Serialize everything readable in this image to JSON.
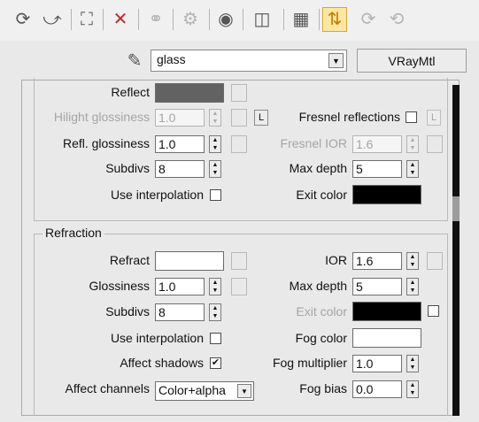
{
  "toolbar": {
    "icons": [
      "get-material-icon",
      "put-to-scene-icon",
      "assign-material-icon",
      "delete-icon",
      "make-unique-icon",
      "put-to-library-icon",
      "material-effects-icon",
      "show-map-icon",
      "show-end-result-icon",
      "go-to-parent-icon",
      "go-forward-icon"
    ]
  },
  "material": {
    "name": "glass",
    "type": "VRayMtl"
  },
  "reflection": {
    "reflect_label": "Reflect",
    "reflect_color": "#626262",
    "hilight_label": "Hilight glossiness",
    "hilight_value": "1.0",
    "lock_label": "L",
    "fresnel_label": "Fresnel reflections",
    "fresnel_lock_label": "L",
    "refl_gloss_label": "Refl. glossiness",
    "refl_gloss_value": "1.0",
    "fresnel_ior_label": "Fresnel IOR",
    "fresnel_ior_value": "1.6",
    "subdivs_label": "Subdivs",
    "subdivs_value": "8",
    "max_depth_label": "Max depth",
    "max_depth_value": "5",
    "use_interp_label": "Use interpolation",
    "exit_color_label": "Exit color",
    "exit_color": "#000000"
  },
  "refraction": {
    "title": "Refraction",
    "refract_label": "Refract",
    "refract_color": "#ffffff",
    "ior_label": "IOR",
    "ior_value": "1.6",
    "glossiness_label": "Glossiness",
    "glossiness_value": "1.0",
    "max_depth_label": "Max depth",
    "max_depth_value": "5",
    "subdivs_label": "Subdivs",
    "subdivs_value": "8",
    "exit_color_label": "Exit color",
    "exit_color": "#000000",
    "use_interp_label": "Use interpolation",
    "fog_color_label": "Fog color",
    "fog_color": "#ffffff",
    "affect_shadows_label": "Affect shadows",
    "affect_shadows_check": "✔",
    "fog_multiplier_label": "Fog multiplier",
    "fog_multiplier_value": "1.0",
    "affect_channels_label": "Affect channels",
    "affect_channels_value": "Color+alpha",
    "fog_bias_label": "Fog bias",
    "fog_bias_value": "0.0"
  }
}
